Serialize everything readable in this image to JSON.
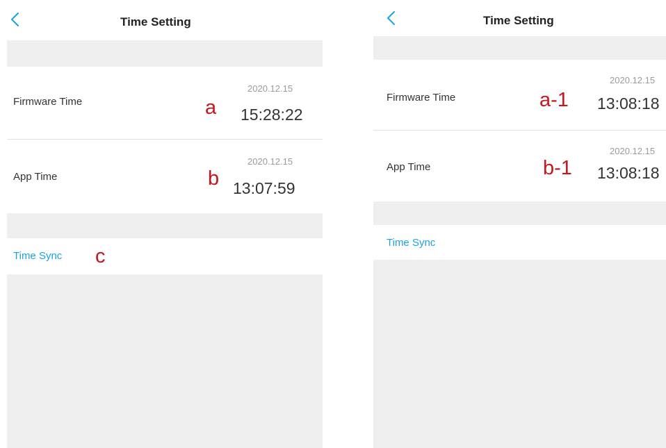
{
  "colors": {
    "accent": "#1aa3e0",
    "annotation": "#c8161d",
    "secondary_text": "#9a9a9a",
    "section_gap": "#efefef"
  },
  "screens": [
    {
      "back_icon": "chevron-left-icon",
      "title": "Time Setting",
      "firmware": {
        "label": "Firmware Time",
        "marker": "a",
        "date": "2020.12.15",
        "time": "15:28:22"
      },
      "app": {
        "label": "App Time",
        "marker": "b",
        "date": "2020.12.15",
        "time": "13:07:59"
      },
      "sync": {
        "label": "Time Sync",
        "marker": "c"
      }
    },
    {
      "back_icon": "chevron-left-icon",
      "title": "Time Setting",
      "firmware": {
        "label": "Firmware Time",
        "marker": "a-1",
        "date": "2020.12.15",
        "time": "13:08:18"
      },
      "app": {
        "label": "App Time",
        "marker": "b-1",
        "date": "2020.12.15",
        "time": "13:08:18"
      },
      "sync": {
        "label": "Time Sync"
      }
    }
  ]
}
